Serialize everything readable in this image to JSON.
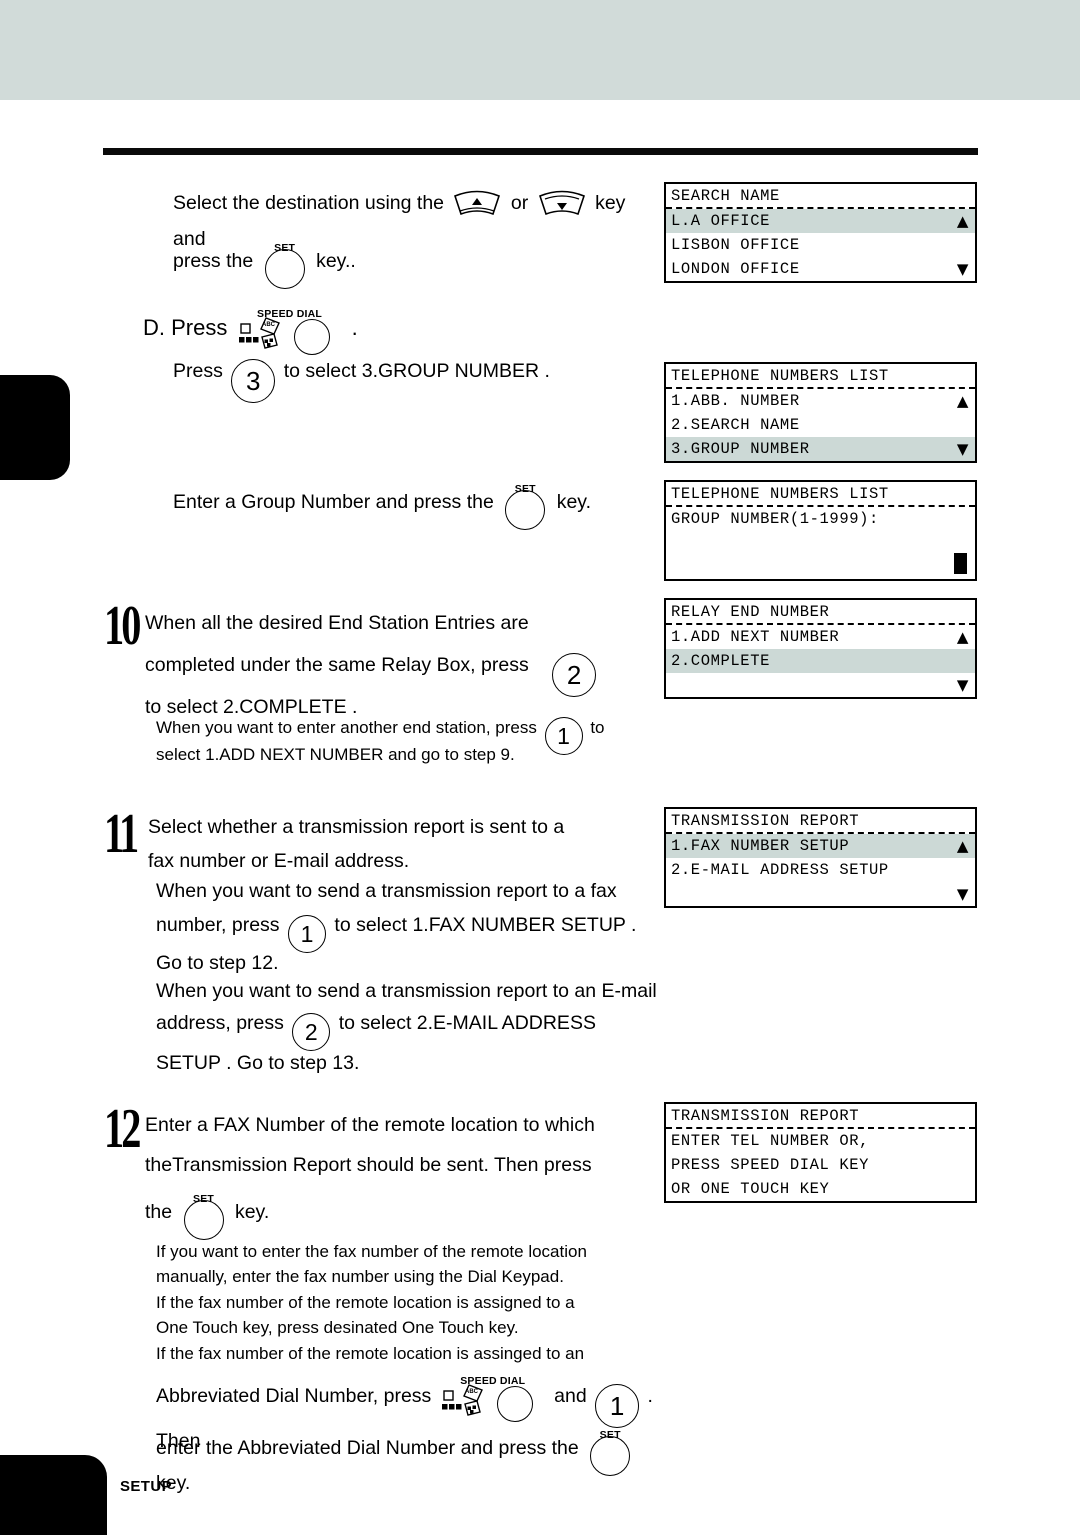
{
  "page": {
    "footer_label": "SETUP",
    "header_band_color": "#d1dbd9",
    "lcd_highlight_color": "#ccd9d6"
  },
  "body": {
    "step9c": {
      "line1_a": "Select the destination using the",
      "line1_or": "or",
      "line1_b": "key and",
      "line2_a": "press the",
      "line2_b": "key..",
      "set_label": "SET"
    },
    "stepD": {
      "prefix": "D.",
      "press": "Press",
      "speed_dial_label": "SPEED DIAL",
      "period": ".",
      "sub_a": "Press",
      "sub_key": "3",
      "sub_b": "to select  3.GROUP NUMBER ."
    },
    "step9d": {
      "text_a": "Enter a Group Number and press the",
      "text_b": "key.",
      "set_label": "SET"
    },
    "step10": {
      "number": "10",
      "line1": "When all the desired End Station Entries are",
      "line2": "completed under the same Relay Box, press",
      "key": "2",
      "line3": "to select  2.COMPLETE .",
      "note1_a": "When you want to enter another end station, press",
      "note_key": "1",
      "note1_b": "to",
      "note2": "select  1.ADD NEXT NUMBER  and go to step 9."
    },
    "step11": {
      "number": "11",
      "line1": "Select whether a transmission report is sent to a",
      "line2": "fax number or E-mail address.",
      "note1": "When you want to send a transmission report to a fax",
      "note2_a": "number, press",
      "note2_key": "1",
      "note2_b": "to select  1.FAX NUMBER SETUP .",
      "note3": "Go to step 12.",
      "note4": "When you want to send a transmission report to an E-mail",
      "note5_a": "address, press",
      "note5_key": "2",
      "note5_b": "to select  2.E-MAIL ADDRESS",
      "note6": "SETUP .  Go to step 13."
    },
    "step12": {
      "number": "12",
      "line1": "Enter a FAX Number of the remote location to which",
      "line2": "theTransmission Report should be sent. Then press",
      "line3_a": "the",
      "line3_b": "key.",
      "set_label": "SET",
      "note1": "If you want to enter the fax number of the remote location",
      "note2": "manually, enter the fax number using the Dial Keypad.",
      "note3": "If the fax number of the remote location is assigned to a",
      "note4": "One Touch key, press desinated One Touch key.",
      "note5": "If the fax number of the remote location is assinged to an",
      "note6_a": "Abbreviated Dial Number, press",
      "note6_speed_dial": "SPEED DIAL",
      "note6_and": "and",
      "note6_key": "1",
      "note6_b": ". Then",
      "note7_a": "enter the Abbreviated Dial Number and press the",
      "note7_b": "key.",
      "note7_set": "SET"
    }
  },
  "lcd_panels": [
    {
      "name": "search-name",
      "title": "SEARCH NAME",
      "rows": [
        {
          "text": "L.A OFFICE",
          "highlight": true,
          "arrow": "▲"
        },
        {
          "text": "LISBON OFFICE",
          "highlight": false,
          "arrow": ""
        },
        {
          "text": "LONDON OFFICE",
          "highlight": false,
          "arrow": "▼"
        }
      ]
    },
    {
      "name": "telephone-numbers-list",
      "title": "TELEPHONE NUMBERS LIST",
      "rows": [
        {
          "text": "1.ABB. NUMBER",
          "highlight": false,
          "arrow": "▲"
        },
        {
          "text": "2.SEARCH NAME",
          "highlight": false,
          "arrow": ""
        },
        {
          "text": "3.GROUP NUMBER",
          "highlight": true,
          "arrow": "▼"
        }
      ]
    },
    {
      "name": "group-number-entry",
      "title": "TELEPHONE NUMBERS LIST",
      "cursor": true,
      "rows": [
        {
          "text": "GROUP NUMBER(1-1999):",
          "highlight": false,
          "arrow": ""
        },
        {
          "text": "",
          "highlight": false,
          "arrow": ""
        },
        {
          "text": "",
          "highlight": false,
          "arrow": ""
        }
      ]
    },
    {
      "name": "relay-end-number",
      "title": "RELAY END NUMBER",
      "rows": [
        {
          "text": "1.ADD NEXT NUMBER",
          "highlight": false,
          "arrow": "▲"
        },
        {
          "text": "2.COMPLETE",
          "highlight": true,
          "arrow": ""
        },
        {
          "text": "",
          "highlight": false,
          "arrow": "▼"
        }
      ]
    },
    {
      "name": "transmission-report-setup",
      "title": "TRANSMISSION REPORT",
      "rows": [
        {
          "text": "1.FAX NUMBER SETUP",
          "highlight": true,
          "arrow": "▲"
        },
        {
          "text": "2.E-MAIL ADDRESS SETUP",
          "highlight": false,
          "arrow": ""
        },
        {
          "text": "",
          "highlight": false,
          "arrow": "▼"
        }
      ]
    },
    {
      "name": "transmission-report-enter-tel",
      "title": "TRANSMISSION REPORT",
      "rows": [
        {
          "text": "ENTER TEL NUMBER OR,",
          "highlight": false,
          "arrow": ""
        },
        {
          "text": "PRESS SPEED DIAL KEY",
          "highlight": false,
          "arrow": ""
        },
        {
          "text": "OR ONE TOUCH KEY",
          "highlight": false,
          "arrow": ""
        }
      ]
    }
  ]
}
